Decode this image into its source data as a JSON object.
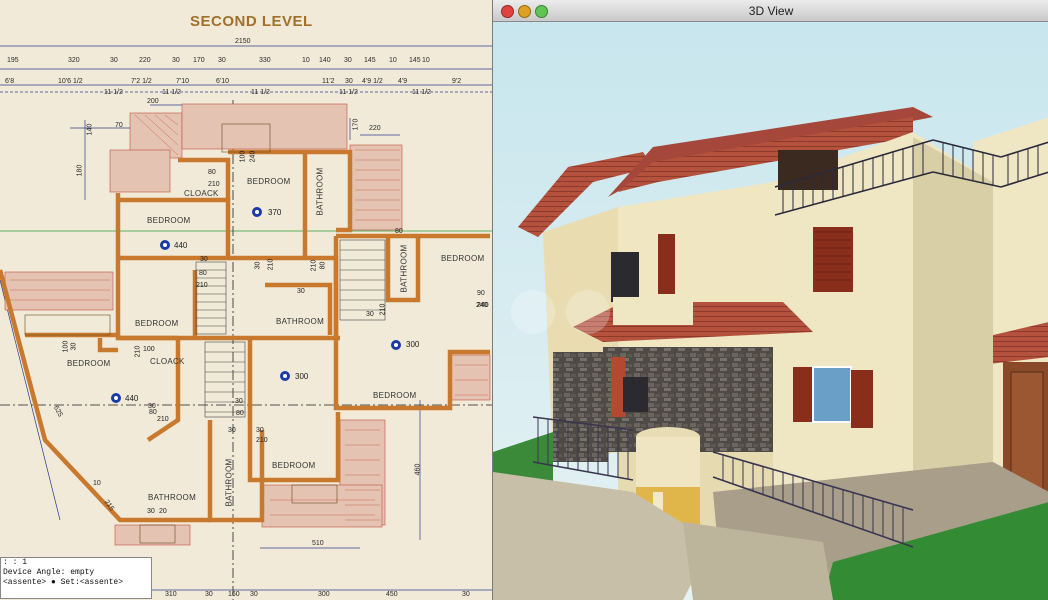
{
  "plan": {
    "title": "SECOND LEVEL",
    "total_width": "2150",
    "dims_row1": [
      "195",
      "320",
      "30",
      "220",
      "30",
      "170",
      "30",
      "330",
      "10",
      "140",
      "30",
      "145",
      "10",
      "145",
      "10"
    ],
    "dims_row2": [
      "6'8",
      "10'6 1/2",
      "7'2 1/2",
      "7'10",
      "6'10",
      "11'2",
      "4'9 1/2",
      "4'9",
      "9'2",
      "30"
    ],
    "dims_row3": [
      "11 1/2",
      "11 1/2",
      "11 1/2",
      "11 1/2",
      "11 1/2"
    ],
    "side_dims": {
      "d200": "200",
      "d70": "70",
      "d140": "140",
      "d170": "170",
      "d220": "220",
      "d180": "180",
      "d90": "90",
      "d240": "240",
      "d625": "625",
      "d10": "10",
      "d215": "215",
      "d460": "460",
      "d510": "510"
    },
    "bottom_dims": [
      "310",
      "30",
      "160",
      "30",
      "300",
      "450",
      "30"
    ],
    "rooms": {
      "bedroom_top": "BEDROOM",
      "cloack_top": "CLOACK",
      "bathroom_top": "BATHROOM",
      "bedroom_left_top": "BEDROOM",
      "bedroom_mid": "BEDROOM",
      "bathroom_mid": "BATHROOM",
      "bathroom_vert_right": "BATHROOM",
      "bedroom_right_top": "BEDROOM",
      "bedroom_left": "BEDROOM",
      "cloack_left": "CLOACK",
      "bedroom_right": "BEDROOM",
      "bedroom_low": "BEDROOM",
      "bathroom_low_vert": "BATHROOM",
      "bathroom_bottom": "BATHROOM"
    },
    "levels": {
      "l370": "370",
      "l440a": "440",
      "l300a": "300",
      "l440b": "440",
      "l300b": "300"
    },
    "small": {
      "s80a": "80",
      "s210a": "210",
      "s100a": "100",
      "s240a": "240",
      "s30a": "30",
      "s210b": "210",
      "s80b": "80",
      "s30b": "30",
      "s210c": "210",
      "s30c": "30",
      "s210d": "210",
      "s80c": "80",
      "s100b": "100",
      "s30d": "30",
      "s210e": "210",
      "s240b": "240",
      "s100c": "100",
      "s80d": "80",
      "s30e": "30",
      "s210f": "210",
      "s30f": "30",
      "s80e": "80",
      "s210g": "210",
      "s30g": "30",
      "s30h": "30",
      "s210h": "210",
      "s30i": "30",
      "s80f": "80",
      "s30j": "30",
      "s20": "20"
    },
    "status_lines": [
      ":   : 1",
      "Device Angle: empty",
      "<assente> ● Set:<assente>"
    ]
  },
  "view3d": {
    "window_title": "3D View",
    "buttons": {
      "close": "#e0443e",
      "minimize": "#dea123",
      "zoom": "#62c454"
    }
  },
  "colors": {
    "paper": "#f1ead8",
    "wall": "#c8792d",
    "roof": "#b5523e",
    "sky": "#cfe9ef",
    "stucco": "#efe6c4"
  }
}
